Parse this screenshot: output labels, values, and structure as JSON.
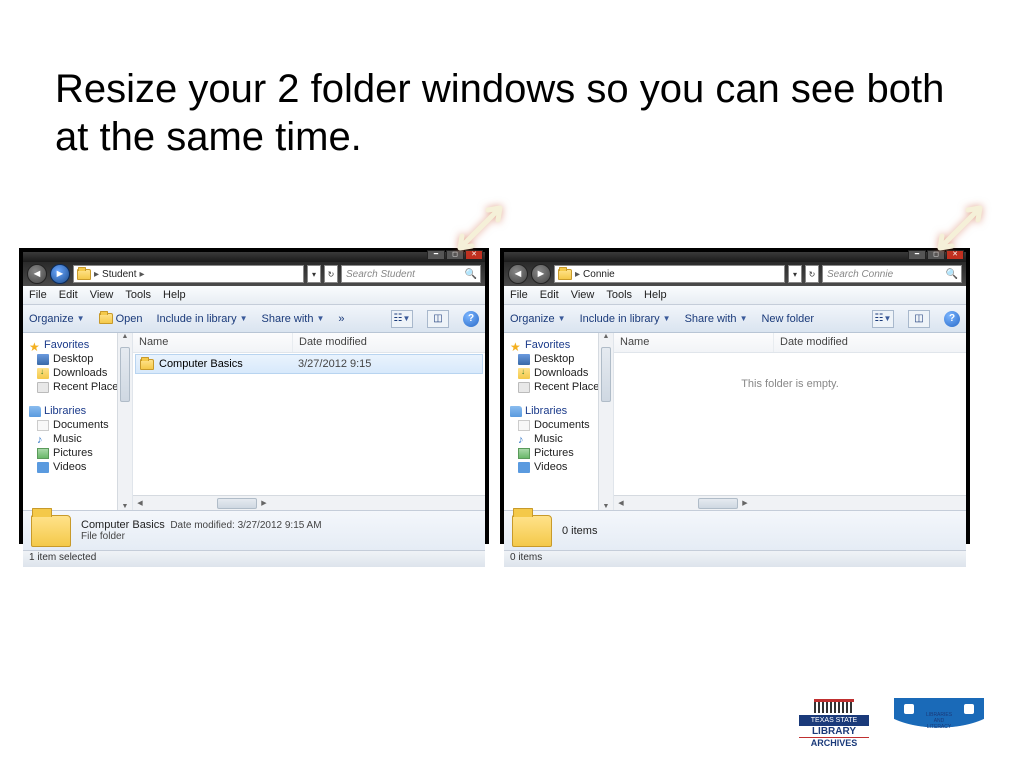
{
  "slide": {
    "title": "Resize your 2 folder windows so you can see both at the same time."
  },
  "menus": {
    "file": "File",
    "edit": "Edit",
    "view": "View",
    "tools": "Tools",
    "help": "Help"
  },
  "cmds": {
    "organize": "Organize",
    "open": "Open",
    "include": "Include in library",
    "share": "Share with",
    "more": "»",
    "newfolder": "New folder"
  },
  "tree": {
    "favorites": "Favorites",
    "desktop": "Desktop",
    "downloads": "Downloads",
    "recent": "Recent Places",
    "libraries": "Libraries",
    "documents": "Documents",
    "music": "Music",
    "pictures": "Pictures",
    "videos": "Videos"
  },
  "list_hdr": {
    "name": "Name",
    "date": "Date modified"
  },
  "win_left": {
    "breadcrumb": "Student",
    "search_placeholder": "Search Student",
    "item": {
      "name": "Computer Basics",
      "date": "3/27/2012 9:15"
    },
    "details": {
      "title": "Computer Basics",
      "meta": "Date modified: 3/27/2012 9:15 AM",
      "type": "File folder"
    },
    "status": "1 item selected"
  },
  "win_right": {
    "breadcrumb": "Connie",
    "search_placeholder": "Search Connie",
    "empty": "This folder is empty.",
    "details_count": "0 items",
    "status": "0 items"
  },
  "logos": {
    "tsla_state": "TEXAS STATE",
    "tsla_l1": "LIBRARY",
    "tsla_l2": "ARCHIVES",
    "ll_l1": "LIBRARIES",
    "ll_and": "AND",
    "ll_l2": "LITERACY"
  }
}
